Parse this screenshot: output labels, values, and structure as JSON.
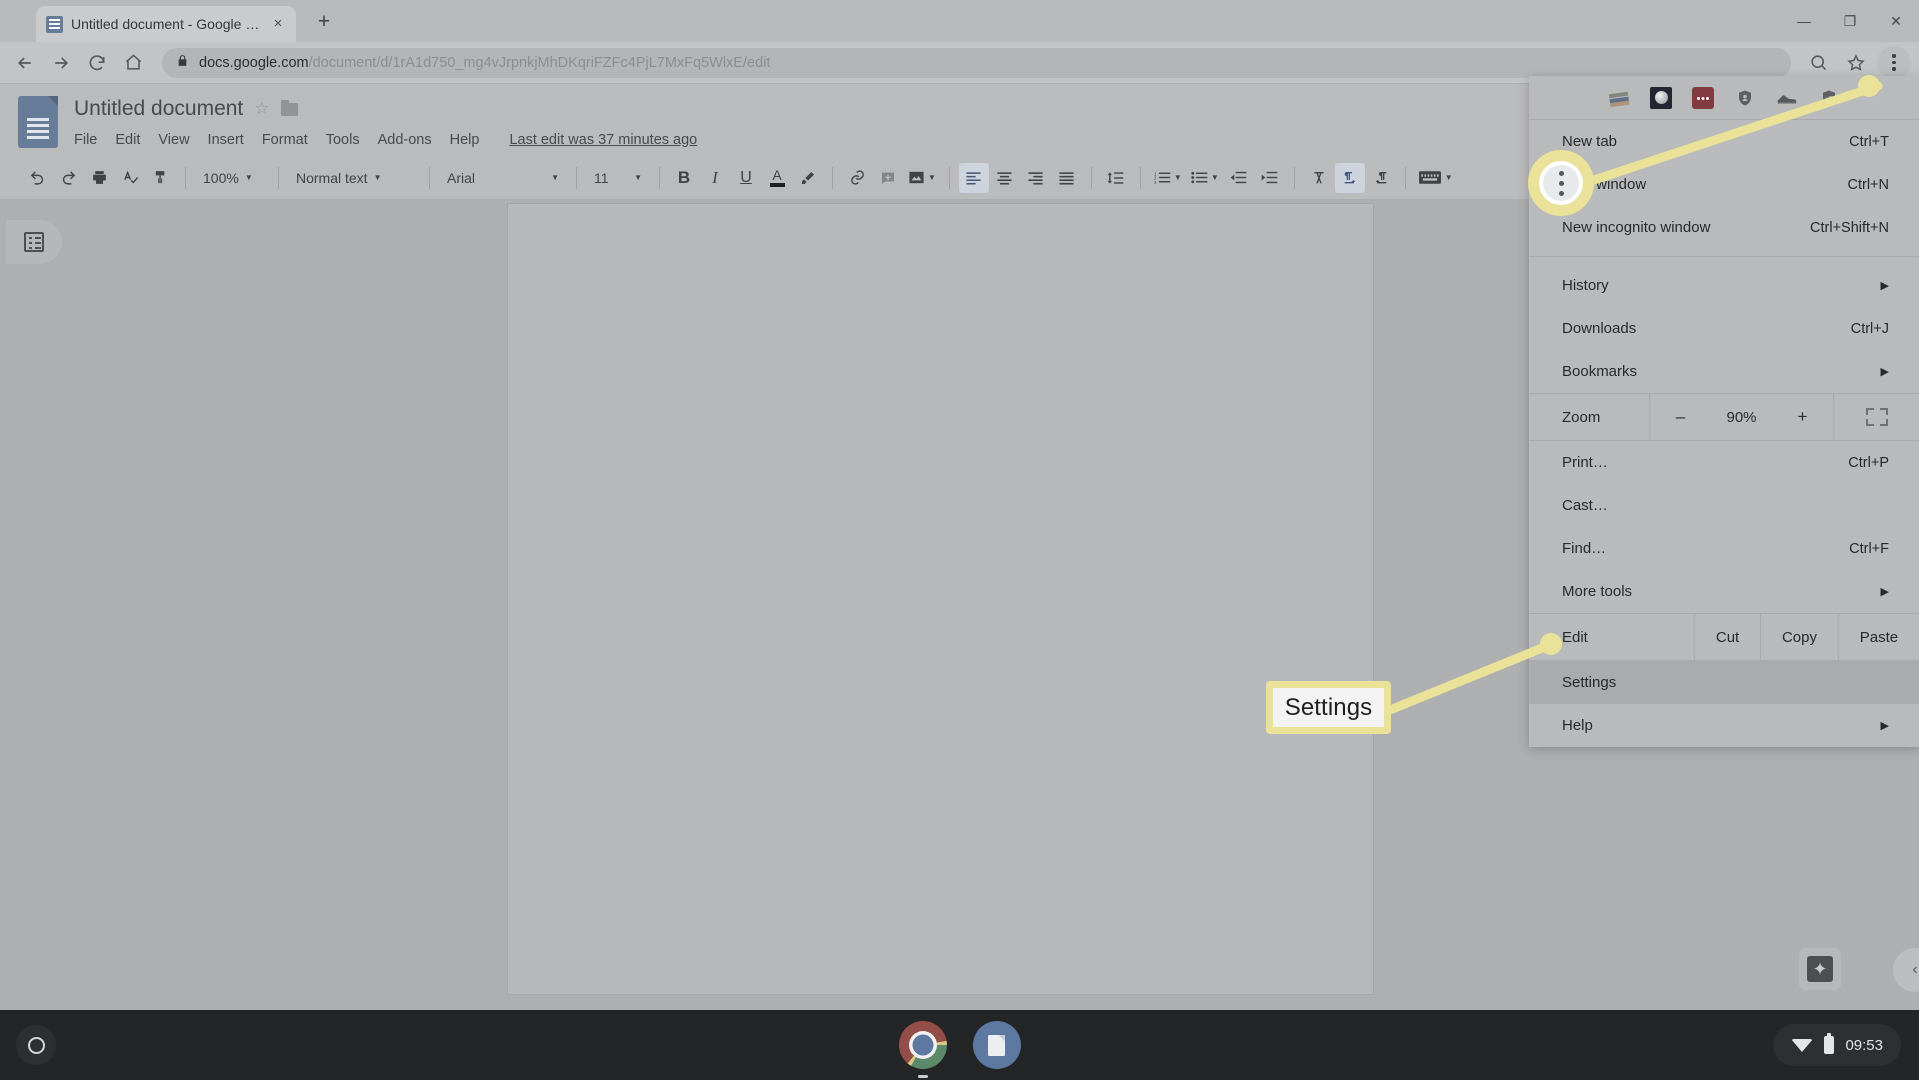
{
  "browser": {
    "tab": {
      "title": "Untitled document - Google Docs",
      "favicon": "docs-favicon",
      "close": "×"
    },
    "new_tab_label": "+",
    "window_controls": {
      "minimize": "—",
      "maximize": "❐",
      "close": "✕"
    },
    "nav": {
      "back": "←",
      "forward": "→",
      "reload": "⟳",
      "home": "⌂"
    },
    "omnibox": {
      "lock": "🔒",
      "url_domain": "docs.google.com",
      "url_path": "/document/d/1rA1d750_mg4vJrpnkjMhDKqriFZFc4PjL7MxFq5WlxE/edit",
      "url_full": "docs.google.com/document/d/1rA1d750_mg4vJrpnkjMhDKqriFZFc4PjL7MxFq5WlxE/edit"
    },
    "zoom_indicator_icon": "zoom-magnifier-icon",
    "bookmark_icon": "☆",
    "menu_button": "three-dot-menu"
  },
  "docs": {
    "title": "Untitled document",
    "star": "☆",
    "folder_icon": "move-to-folder-icon",
    "menus": [
      "File",
      "Edit",
      "View",
      "Insert",
      "Format",
      "Tools",
      "Add-ons",
      "Help"
    ],
    "last_edit": "Last edit was 37 minutes ago",
    "toolbar": {
      "undo": "↶",
      "redo": "↷",
      "print": "print-icon",
      "spelling": "spell-check-icon",
      "paint_format": "paint-format-icon",
      "zoom_value": "100%",
      "style_value": "Normal text",
      "font_value": "Arial",
      "size_value": "11",
      "bold": "B",
      "italic": "I",
      "underline": "U",
      "text_color": "A",
      "highlight": "highlight-icon",
      "link": "link-icon",
      "comment": "add-comment-icon",
      "image": "insert-image-icon",
      "align_left": "align-left-icon",
      "align_center": "align-center-icon",
      "align_right": "align-right-icon",
      "align_justify": "align-justify-icon",
      "line_spacing": "line-spacing-icon",
      "numbered_list": "numbered-list-icon",
      "bulleted_list": "bulleted-list-icon",
      "decrease_indent": "decrease-indent-icon",
      "increase_indent": "increase-indent-icon",
      "clear_formatting": "clear-formatting-icon",
      "ltr": "left-to-right-icon",
      "rtl": "right-to-left-icon",
      "input_tools": "input-tools-icon"
    },
    "outline_button": "document-outline-icon",
    "explore_button": "explore-icon",
    "sidebar_collapse": "‹"
  },
  "chrome_menu": {
    "extensions": [
      {
        "name": "bookstack-extension-icon"
      },
      {
        "name": "dark-mode-extension-icon"
      },
      {
        "name": "red-badge-extension-icon"
      },
      {
        "name": "shield-extension-icon"
      },
      {
        "name": "sneaker-extension-icon"
      },
      {
        "name": "ublock-extension-icon"
      }
    ],
    "items": [
      {
        "label": "New tab",
        "accel": "Ctrl+T",
        "arrow": ""
      },
      {
        "label": "New window",
        "accel": "Ctrl+N",
        "arrow": ""
      },
      {
        "label": "New incognito window",
        "accel": "Ctrl+Shift+N",
        "arrow": ""
      },
      {
        "label": "History",
        "accel": "",
        "arrow": "▶"
      },
      {
        "label": "Downloads",
        "accel": "Ctrl+J",
        "arrow": ""
      },
      {
        "label": "Bookmarks",
        "accel": "",
        "arrow": "▶"
      }
    ],
    "zoom": {
      "label": "Zoom",
      "minus": "–",
      "value": "90%",
      "plus": "+",
      "fullscreen_icon": "fullscreen-icon"
    },
    "items2": [
      {
        "label": "Print…",
        "accel": "Ctrl+P",
        "arrow": ""
      },
      {
        "label": "Cast…",
        "accel": "",
        "arrow": ""
      },
      {
        "label": "Find…",
        "accel": "Ctrl+F",
        "arrow": ""
      },
      {
        "label": "More tools",
        "accel": "",
        "arrow": "▶"
      }
    ],
    "edit": {
      "label": "Edit",
      "cut": "Cut",
      "copy": "Copy",
      "paste": "Paste"
    },
    "settings": {
      "label": "Settings",
      "selected": true
    },
    "help": {
      "label": "Help",
      "arrow": "▶"
    }
  },
  "annotations": {
    "callout_label": "Settings",
    "highlight_color": "#f7e837",
    "ring_target": "three-dot-menu-button",
    "dot_target": "settings-menu-item"
  },
  "shelf": {
    "launcher": "launcher-icon",
    "apps": [
      {
        "name": "chrome-app-icon"
      },
      {
        "name": "files-app-icon"
      }
    ],
    "status": {
      "wifi": "wifi-icon",
      "battery": "battery-icon",
      "time": "09:53"
    }
  }
}
